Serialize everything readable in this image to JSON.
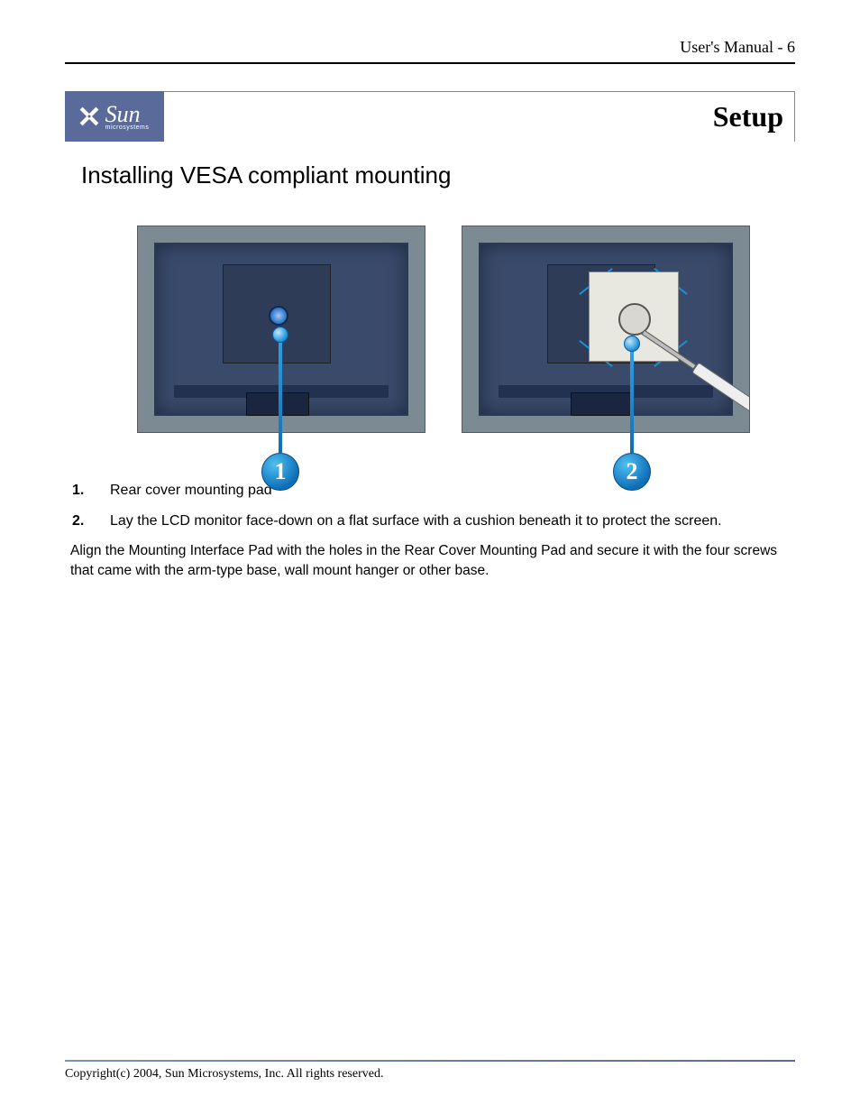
{
  "header": {
    "running_head": "User's Manual - 6"
  },
  "logo": {
    "brand": "Sun",
    "subbrand": "microsystems"
  },
  "title": "Setup",
  "section_heading": "Installing VESA compliant mounting",
  "callouts": {
    "fig1_number": "1",
    "fig2_number": "2"
  },
  "steps": [
    {
      "num": "1.",
      "text": "Rear cover mounting pad"
    },
    {
      "num": "2.",
      "text": "Lay the LCD monitor face-down on a flat surface with a cushion beneath it to protect the screen."
    }
  ],
  "paragraph": "Align the Mounting Interface Pad with the holes in the Rear Cover Mounting Pad and secure it with the four screws that came with the arm-type base, wall mount hanger or other base.",
  "footer": "Copyright(c) 2004, Sun Microsystems, Inc. All rights reserved."
}
